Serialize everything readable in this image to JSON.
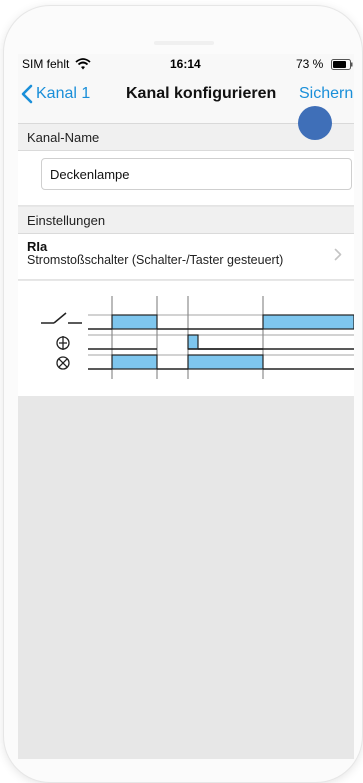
{
  "status_bar": {
    "carrier": "SIM fehlt",
    "time": "16:14",
    "battery": "73 %",
    "wifi_icon": "wifi-icon",
    "battery_icon": "battery-icon"
  },
  "nav": {
    "back_label": "Kanal 1",
    "title": "Kanal konfigurieren",
    "save_label": "Sichern"
  },
  "sections": {
    "name_header": "Kanal-Name",
    "settings_header": "Einstellungen"
  },
  "channel_name": {
    "value": "Deckenlampe",
    "placeholder": ""
  },
  "mode": {
    "title": "RIa",
    "description": "Stromstoßschalter (Schalter-/Taster gesteuert)"
  },
  "timing_diagram": {
    "rows": [
      {
        "symbol": "switch-contact-icon",
        "states": [
          0,
          1,
          0,
          0,
          1
        ]
      },
      {
        "symbol": "pushbutton-icon",
        "states": [
          0,
          0,
          1,
          0,
          0
        ]
      },
      {
        "symbol": "lamp-icon",
        "states": [
          0,
          1,
          0,
          1,
          0
        ]
      }
    ],
    "fill_color": "#7ec6ee"
  },
  "colors": {
    "accent": "#1a8fd9",
    "touch_indicator": "#3f6fb8"
  }
}
